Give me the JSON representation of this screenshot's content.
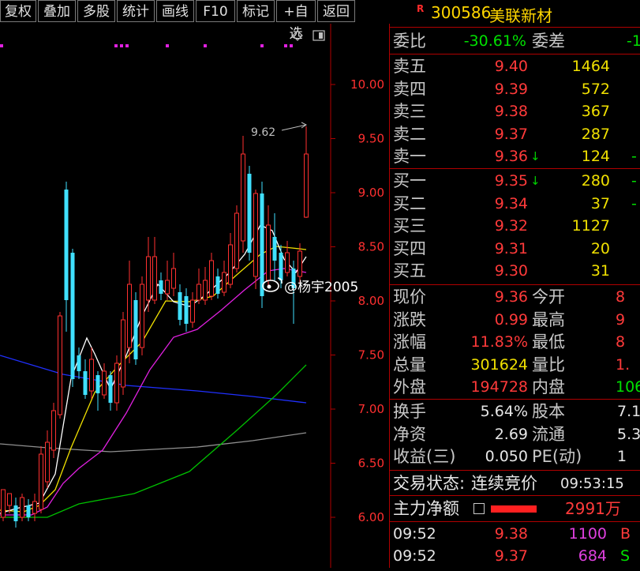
{
  "toolbar": {
    "items": [
      "复权",
      "叠加",
      "多股",
      "统计",
      "画线",
      "F10",
      "标记",
      "+自选",
      "返回"
    ]
  },
  "chart": {
    "price_labels": [
      "10.00",
      "9.50",
      "9.00",
      "8.50",
      "8.00",
      "7.50",
      "7.00",
      "6.50",
      "6.00"
    ],
    "peak_label": "9.62",
    "watermark": "@杨宇2005",
    "colors": {
      "up": "#ff3030",
      "down": "#40e0ff",
      "ma5": "#ffffff",
      "ma10": "#f0e000",
      "ma20": "#e020e0",
      "ma60": "#00c000",
      "ma120": "#2030ff",
      "ma250": "#909090"
    }
  },
  "quote": {
    "r_mark": "R",
    "code": "300586",
    "name": "美联新材",
    "weibi_label": "委比",
    "weibi_value": "-30.61%",
    "weicha_label": "委差",
    "weicha_value": "-1",
    "asks": [
      {
        "label": "卖五",
        "price": "9.40",
        "vol": "1464",
        "chg": "",
        "arrow": ""
      },
      {
        "label": "卖四",
        "price": "9.39",
        "vol": "572",
        "chg": "",
        "arrow": ""
      },
      {
        "label": "卖三",
        "price": "9.38",
        "vol": "367",
        "chg": "",
        "arrow": ""
      },
      {
        "label": "卖二",
        "price": "9.37",
        "vol": "287",
        "chg": "",
        "arrow": ""
      },
      {
        "label": "卖一",
        "price": "9.36",
        "vol": "124",
        "chg": "-",
        "arrow": "↓"
      }
    ],
    "bids": [
      {
        "label": "买一",
        "price": "9.35",
        "vol": "280",
        "chg": "-",
        "arrow": "↓"
      },
      {
        "label": "买二",
        "price": "9.34",
        "vol": "37",
        "chg": "-",
        "arrow": ""
      },
      {
        "label": "买三",
        "price": "9.32",
        "vol": "1127",
        "chg": "",
        "arrow": ""
      },
      {
        "label": "买四",
        "price": "9.31",
        "vol": "20",
        "chg": "",
        "arrow": ""
      },
      {
        "label": "买五",
        "price": "9.30",
        "vol": "31",
        "chg": "",
        "arrow": ""
      }
    ],
    "stats": [
      {
        "l1": "现价",
        "v1": "9.36",
        "c1": "red",
        "l2": "今开",
        "v2": "8",
        "c2": "red"
      },
      {
        "l1": "涨跌",
        "v1": "0.99",
        "c1": "red",
        "l2": "最高",
        "v2": "9",
        "c2": "red"
      },
      {
        "l1": "涨幅",
        "v1": "11.83%",
        "c1": "red",
        "l2": "最低",
        "v2": "8",
        "c2": "red"
      },
      {
        "l1": "总量",
        "v1": "301624",
        "c1": "yel",
        "l2": "量比",
        "v2": "1.",
        "c2": "red"
      },
      {
        "l1": "外盘",
        "v1": "194728",
        "c1": "red",
        "l2": "内盘",
        "v2": "106",
        "c2": "grn"
      }
    ],
    "fin": [
      {
        "l1": "换手",
        "v1": "5.64%",
        "l2": "股本",
        "v2": "7.1"
      },
      {
        "l1": "净资",
        "v1": "2.69",
        "l2": "流通",
        "v2": "5.3"
      },
      {
        "l1": "收益(三)",
        "v1": "0.050",
        "l2": "PE(动)",
        "v2": "1"
      }
    ],
    "status_label": "交易状态:",
    "status_value": "连续竞价",
    "status_time": "09:53:15",
    "netflow_label": "主力净额",
    "netflow_value": "2991万",
    "ticks": [
      {
        "time": "09:52",
        "price": "9.38",
        "vol": "1100",
        "side": "B",
        "vc": "mag",
        "sc": "red"
      },
      {
        "time": "09:52",
        "price": "9.37",
        "vol": "684",
        "side": "S",
        "vc": "mag",
        "sc": "grn"
      }
    ]
  }
}
